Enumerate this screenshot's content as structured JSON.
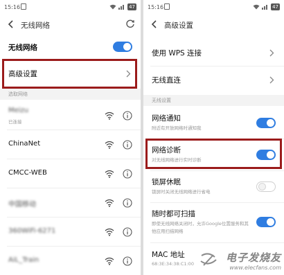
{
  "left": {
    "status": {
      "time": "15:16",
      "battery": "47"
    },
    "title": "无线网络",
    "wifi_row": {
      "label": "无线网络",
      "enabled": true
    },
    "advanced_row": {
      "label": "高级设置"
    },
    "section_label": "选取网络",
    "networks": [
      {
        "name": "Meizu",
        "status": "已连接",
        "blurred": true
      },
      {
        "name": "ChinaNet",
        "status": "",
        "blurred": false
      },
      {
        "name": "CMCC-WEB",
        "status": "",
        "blurred": false
      },
      {
        "name": "中国移动",
        "status": "",
        "blurred": true
      },
      {
        "name": "360WiFi-6271",
        "status": "",
        "blurred": true
      },
      {
        "name": "AiL_Train",
        "status": "",
        "blurred": true
      }
    ]
  },
  "right": {
    "status": {
      "time": "15:16",
      "battery": "47"
    },
    "title": "高级设置",
    "wps": {
      "label": "使用 WPS 连接"
    },
    "direct": {
      "label": "无线直连"
    },
    "section_label": "无线设置",
    "settings": [
      {
        "title": "网络通知",
        "sub": "附近有开放网络时通知我",
        "on": true
      },
      {
        "title": "网络诊断",
        "sub": "对无线网络进行实时诊断",
        "on": true
      },
      {
        "title": "锁屏休眠",
        "sub": "锁屏时关闭无线网络进行省电",
        "on": false
      },
      {
        "title": "随时都可扫描",
        "sub": "即使无线网络关闭时，允许Google位置服务和其他应用扫描网络",
        "on": true
      }
    ],
    "mac": {
      "label": "MAC 地址",
      "value": "68:3E:34:38:C1:00"
    }
  },
  "watermark": {
    "main": "电子发烧友",
    "url": "www.elecfans.com"
  },
  "colors": {
    "accent": "#2f7de1",
    "highlight": "#9b1b1b"
  }
}
